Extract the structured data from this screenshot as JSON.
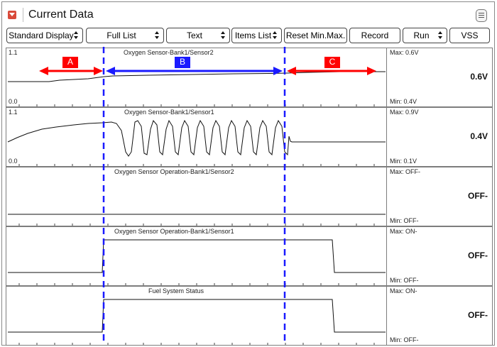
{
  "window": {
    "title": "Current Data",
    "title_icon": "chevron-down-icon",
    "menu_icon": "menu-icon"
  },
  "toolbar": {
    "buttons": [
      {
        "label": "Standard Display",
        "dropdown": true
      },
      {
        "label": "Full List",
        "dropdown": true
      },
      {
        "label": "Text",
        "dropdown": true
      },
      {
        "label": "Items List",
        "dropdown": true
      },
      {
        "label": "Reset Min.Max.",
        "dropdown": false
      },
      {
        "label": "Record",
        "dropdown": false
      },
      {
        "label": "Run",
        "dropdown": true
      },
      {
        "label": "VSS",
        "dropdown": false
      }
    ]
  },
  "panels": [
    {
      "name": "Oxygen Sensor-Bank1/Sensor2",
      "axis_top": "1.1",
      "axis_bottom": "0.0",
      "max": "Max:  0.6V",
      "min": "Min:  0.4V",
      "value": "0.6V"
    },
    {
      "name": "Oxygen Sensor-Bank1/Sensor1",
      "axis_top": "1.1",
      "axis_bottom": "0.0",
      "max": "Max:  0.9V",
      "min": "Min:  0.1V",
      "value": "0.4V"
    },
    {
      "name": "Oxygen Sensor Operation-Bank1/Sensor2",
      "axis_top": "",
      "axis_bottom": "",
      "max": "Max: OFF-",
      "min": "Min: OFF-",
      "value": "OFF-"
    },
    {
      "name": "Oxygen Sensor Operation-Bank1/Sensor1",
      "axis_top": "",
      "axis_bottom": "",
      "max": "Max: ON-",
      "min": "Min: OFF-",
      "value": "OFF-"
    },
    {
      "name": "Fuel System Status",
      "axis_top": "",
      "axis_bottom": "",
      "max": "Max: ON-",
      "min": "Min: OFF-",
      "value": "OFF-"
    }
  ],
  "annotations": {
    "a": "A",
    "b": "B",
    "c": "C",
    "red": "#ff0000",
    "blue": "#1a1aff"
  }
}
